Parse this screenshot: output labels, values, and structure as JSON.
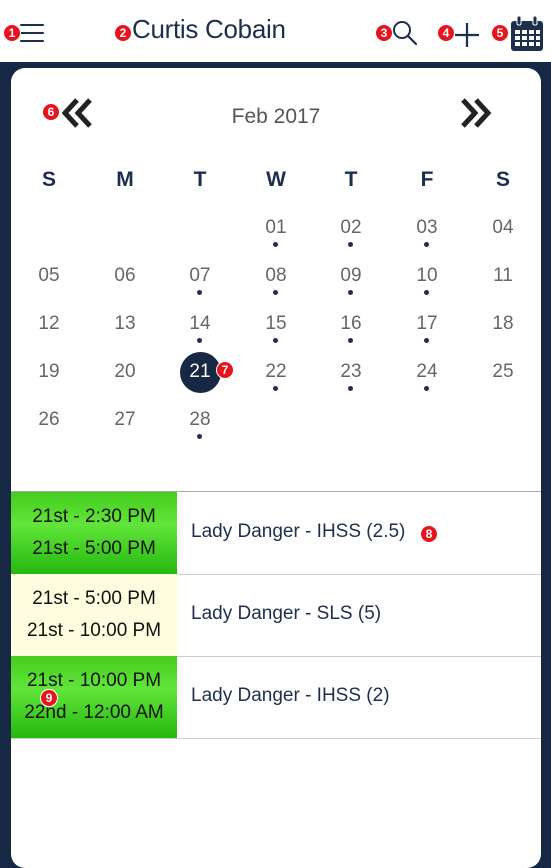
{
  "header": {
    "title": "Curtis Cobain",
    "badges": [
      "1",
      "2",
      "3",
      "4",
      "5"
    ]
  },
  "calendar": {
    "month_label": "Feb 2017",
    "prev_label": "«",
    "next_label": "»",
    "badge_prev": "6",
    "badge_selected": "7",
    "weekdays": [
      "S",
      "M",
      "T",
      "W",
      "T",
      "F",
      "S"
    ],
    "weeks": [
      [
        null,
        null,
        null,
        "01",
        "02",
        "03",
        "04"
      ],
      [
        "05",
        "06",
        "07",
        "08",
        "09",
        "10",
        "11"
      ],
      [
        "12",
        "13",
        "14",
        "15",
        "16",
        "17",
        "18"
      ],
      [
        "19",
        "20",
        "21",
        "22",
        "23",
        "24",
        "25"
      ],
      [
        "26",
        "27",
        "28",
        null,
        null,
        null,
        null
      ]
    ],
    "dotted_days": [
      "01",
      "02",
      "03",
      "07",
      "08",
      "09",
      "10",
      "14",
      "15",
      "16",
      "17",
      "22",
      "23",
      "24",
      "28"
    ],
    "selected_day": "21"
  },
  "events": [
    {
      "start": "21st - 2:30 PM",
      "end": "21st - 5:00 PM",
      "title": "Lady Danger - IHSS (2.5)",
      "style": "green",
      "badge": "8"
    },
    {
      "start": "21st - 5:00 PM",
      "end": "21st - 10:00 PM",
      "title": "Lady Danger - SLS (5)",
      "style": "cream"
    },
    {
      "start": "21st - 10:00 PM",
      "end": "22nd - 12:00 AM",
      "title": "Lady Danger - IHSS (2)",
      "style": "green",
      "badge": "9"
    }
  ],
  "colors": {
    "navy": "#162844",
    "green": "#44cc1e",
    "cream": "#fffde0",
    "badge": "#e8141d"
  },
  "icons": [
    "menu-icon",
    "search-icon",
    "plus-icon",
    "calendar-icon",
    "chevron-left-double-icon",
    "chevron-right-double-icon"
  ]
}
